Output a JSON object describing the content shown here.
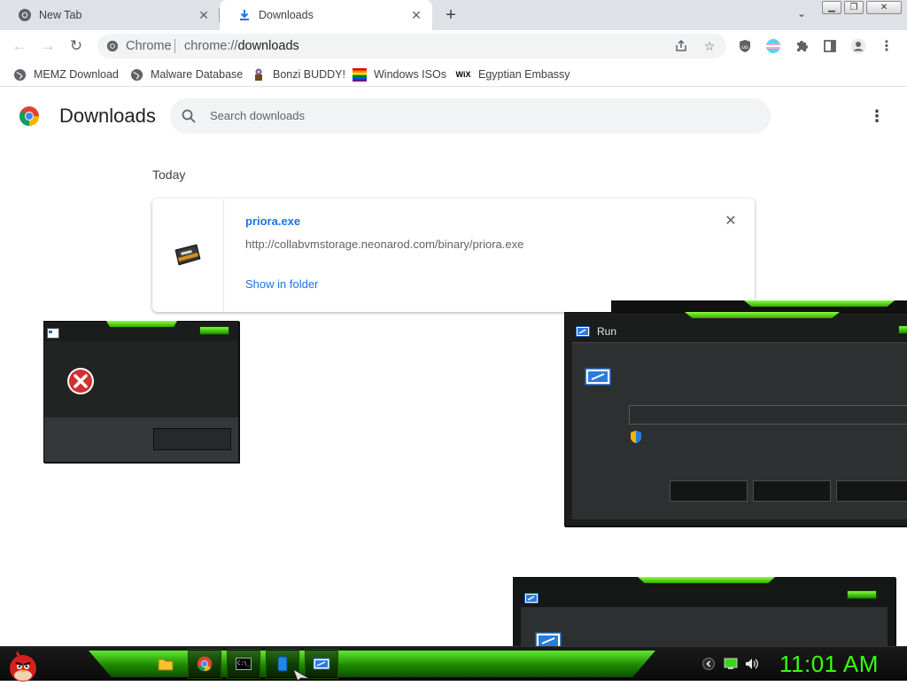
{
  "browser": {
    "tabs": [
      {
        "label": "New Tab",
        "icon": "chrome-icon",
        "active": false
      },
      {
        "label": "Downloads",
        "icon": "download-icon",
        "active": true
      }
    ],
    "omnibox": {
      "chip": "Chrome",
      "url_scheme": "chrome://",
      "url_host": "downloads"
    },
    "bookmarks": [
      {
        "label": "MEMZ Download",
        "icon": "globe-icon"
      },
      {
        "label": "Malware Database",
        "icon": "globe-icon"
      },
      {
        "label": "Bonzi BUDDY!",
        "icon": "bonzi-icon"
      },
      {
        "label": "Windows ISOs",
        "icon": "windows-flag-icon"
      },
      {
        "label": "Egyptian Embassy",
        "icon": "wix-icon"
      }
    ],
    "wix_logo_text": "WiX"
  },
  "downloads_page": {
    "title": "Downloads",
    "search_placeholder": "Search downloads",
    "section_label": "Today",
    "items": [
      {
        "filename": "priora.exe",
        "url": "http://collabvmstorage.neonarod.com/binary/priora.exe",
        "action": "Show in folder"
      }
    ]
  },
  "dialogs": {
    "run_title": "Run"
  },
  "taskbar": {
    "clock": "11:01 AM",
    "cmd_label": "C:\\_"
  },
  "colors": {
    "link_blue": "#1a73e8",
    "accent_green": "#39ff14",
    "tab_strip": "#dee1e6"
  }
}
